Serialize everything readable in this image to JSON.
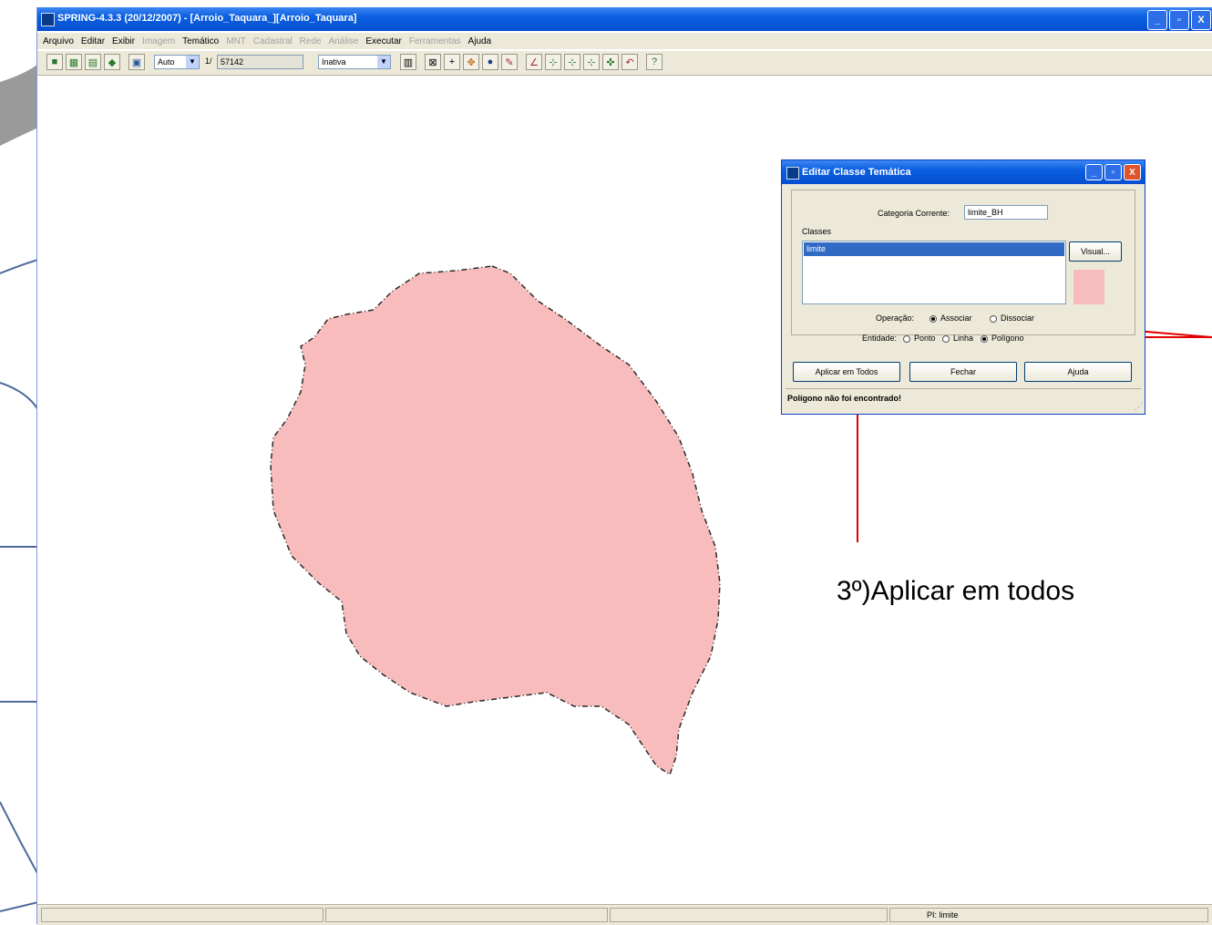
{
  "window": {
    "title": "SPRING-4.3.3 (20/12/2007) - [Arroio_Taquara_][Arroio_Taquara]",
    "minimize": "_",
    "maximize": "▫",
    "close": "X"
  },
  "menu": [
    {
      "label": "Arquivo",
      "enabled": true
    },
    {
      "label": "Editar",
      "enabled": true
    },
    {
      "label": "Exibir",
      "enabled": true
    },
    {
      "label": "Imagem",
      "enabled": false
    },
    {
      "label": "Temático",
      "enabled": true
    },
    {
      "label": "MNT",
      "enabled": false
    },
    {
      "label": "Cadastral",
      "enabled": false
    },
    {
      "label": "Rede",
      "enabled": false
    },
    {
      "label": "Análise",
      "enabled": false
    },
    {
      "label": "Executar",
      "enabled": true
    },
    {
      "label": "Ferramentas",
      "enabled": false
    },
    {
      "label": "Ajuda",
      "enabled": true
    }
  ],
  "toolbar": {
    "scale_mode": "Auto",
    "scale_prefix": "1/",
    "scale_value": "57142",
    "mode_select": "Inativa"
  },
  "status": {
    "pi_label": "PI: limite"
  },
  "dialog": {
    "title": "Editar Classe Temática",
    "categoria_label": "Categoria Corrente:",
    "categoria_value": "limite_BH",
    "classes_label": "Classes",
    "selected_class": "limite",
    "visual_button": "Visual...",
    "operacao_label": "Operação:",
    "associar_label": "Associar",
    "desassociar_label": "Dissociar",
    "entidade_label": "Entidade:",
    "ponto_label": "Ponto",
    "linha_label": "Linha",
    "poligono_label": "Polígono",
    "apply_all_button": "Aplicar em Todos",
    "close_button": "Fechar",
    "help_button": "Ajuda",
    "status_message": "Polígono não foi encontrado!",
    "swatch_color": "#f7bcbc"
  },
  "annotation": {
    "text": "3º)Aplicar em todos",
    "arrow_color": "#e00000"
  },
  "polygon_fill": "#f9bcbc"
}
